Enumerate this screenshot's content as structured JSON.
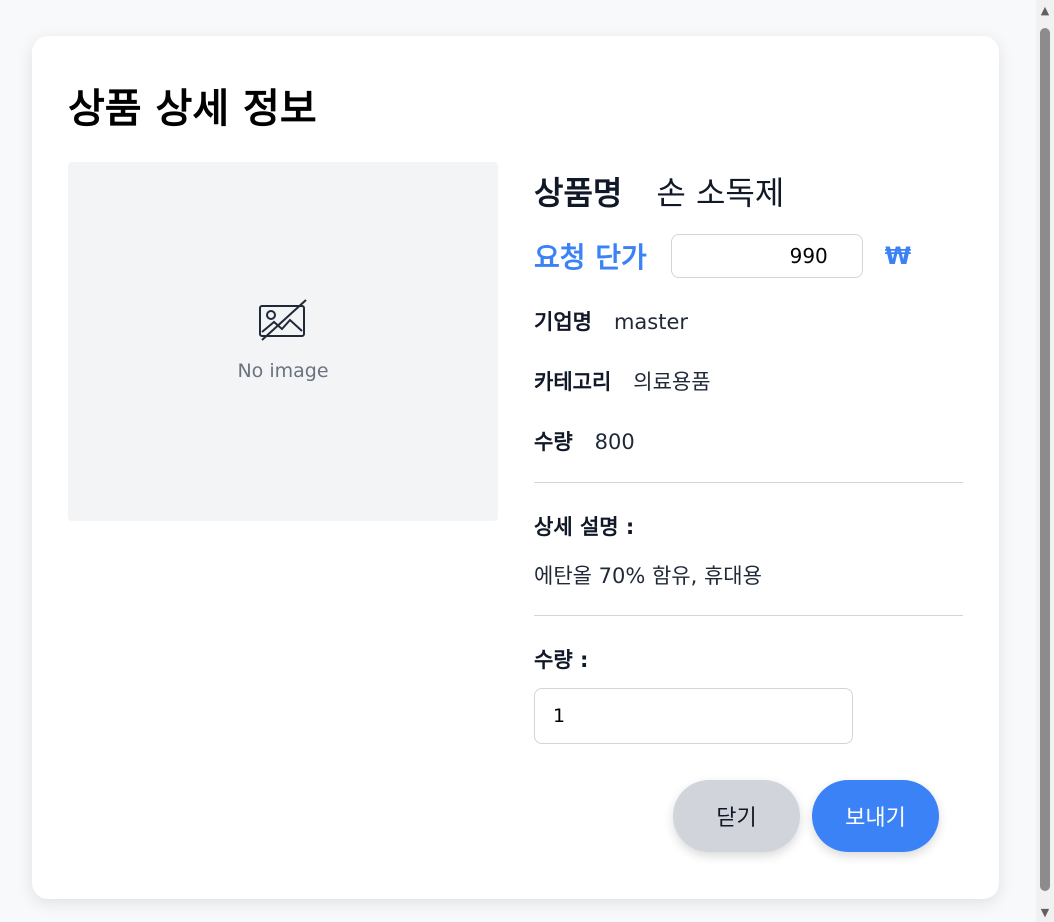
{
  "modal": {
    "title": "상품 상세 정보",
    "image_placeholder": {
      "icon": "image-off-icon",
      "text": "No image"
    },
    "product_name": {
      "label": "상품명",
      "value": "손 소독제"
    },
    "request_price": {
      "label": "요청 단가",
      "value": "990",
      "currency": "₩"
    },
    "company": {
      "label": "기업명",
      "value": "master"
    },
    "category": {
      "label": "카테고리",
      "value": "의료용품"
    },
    "stock_quantity": {
      "label": "수량",
      "value": "800"
    },
    "description": {
      "label": "상세 설명 :",
      "value": "에탄올 70% 함유, 휴대용"
    },
    "order_quantity": {
      "label": "수량 :",
      "value": "1"
    },
    "buttons": {
      "close": "닫기",
      "send": "보내기"
    }
  },
  "colors": {
    "accent": "#3b82f6",
    "close_button": "#d1d5db",
    "image_bg": "#f3f4f6"
  }
}
